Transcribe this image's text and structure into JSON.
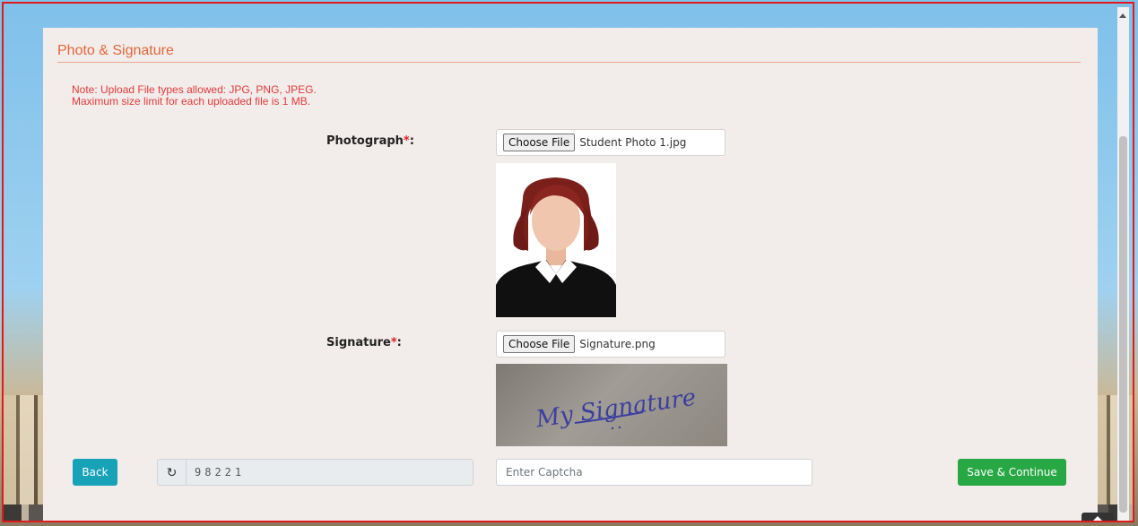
{
  "section": {
    "title": "Photo & Signature",
    "note_line1": "Note: Upload File types allowed: JPG, PNG, JPEG.",
    "note_line2": "Maximum size limit for each uploaded file is 1 MB."
  },
  "photograph": {
    "label": "Photograph",
    "required_mark": "*",
    "colon": ":",
    "button_label": "Choose File",
    "file_name": "Student Photo 1.jpg"
  },
  "signature": {
    "label": "Signature",
    "required_mark": "*",
    "colon": ":",
    "button_label": "Choose File",
    "file_name": "Signature.png",
    "image_text": "My Signature"
  },
  "actions": {
    "back_label": "Back",
    "captcha_code": "98221",
    "captcha_placeholder": "Enter Captcha",
    "save_label": "Save & Continue"
  },
  "icons": {
    "refresh": "refresh-icon",
    "scroll_top": "chevron-up-icon"
  },
  "colors": {
    "accent": "#e0673a",
    "note": "#e23b3b",
    "back_button": "#17a2b8",
    "save_button": "#28a745",
    "frame_border": "#e01b1b"
  }
}
